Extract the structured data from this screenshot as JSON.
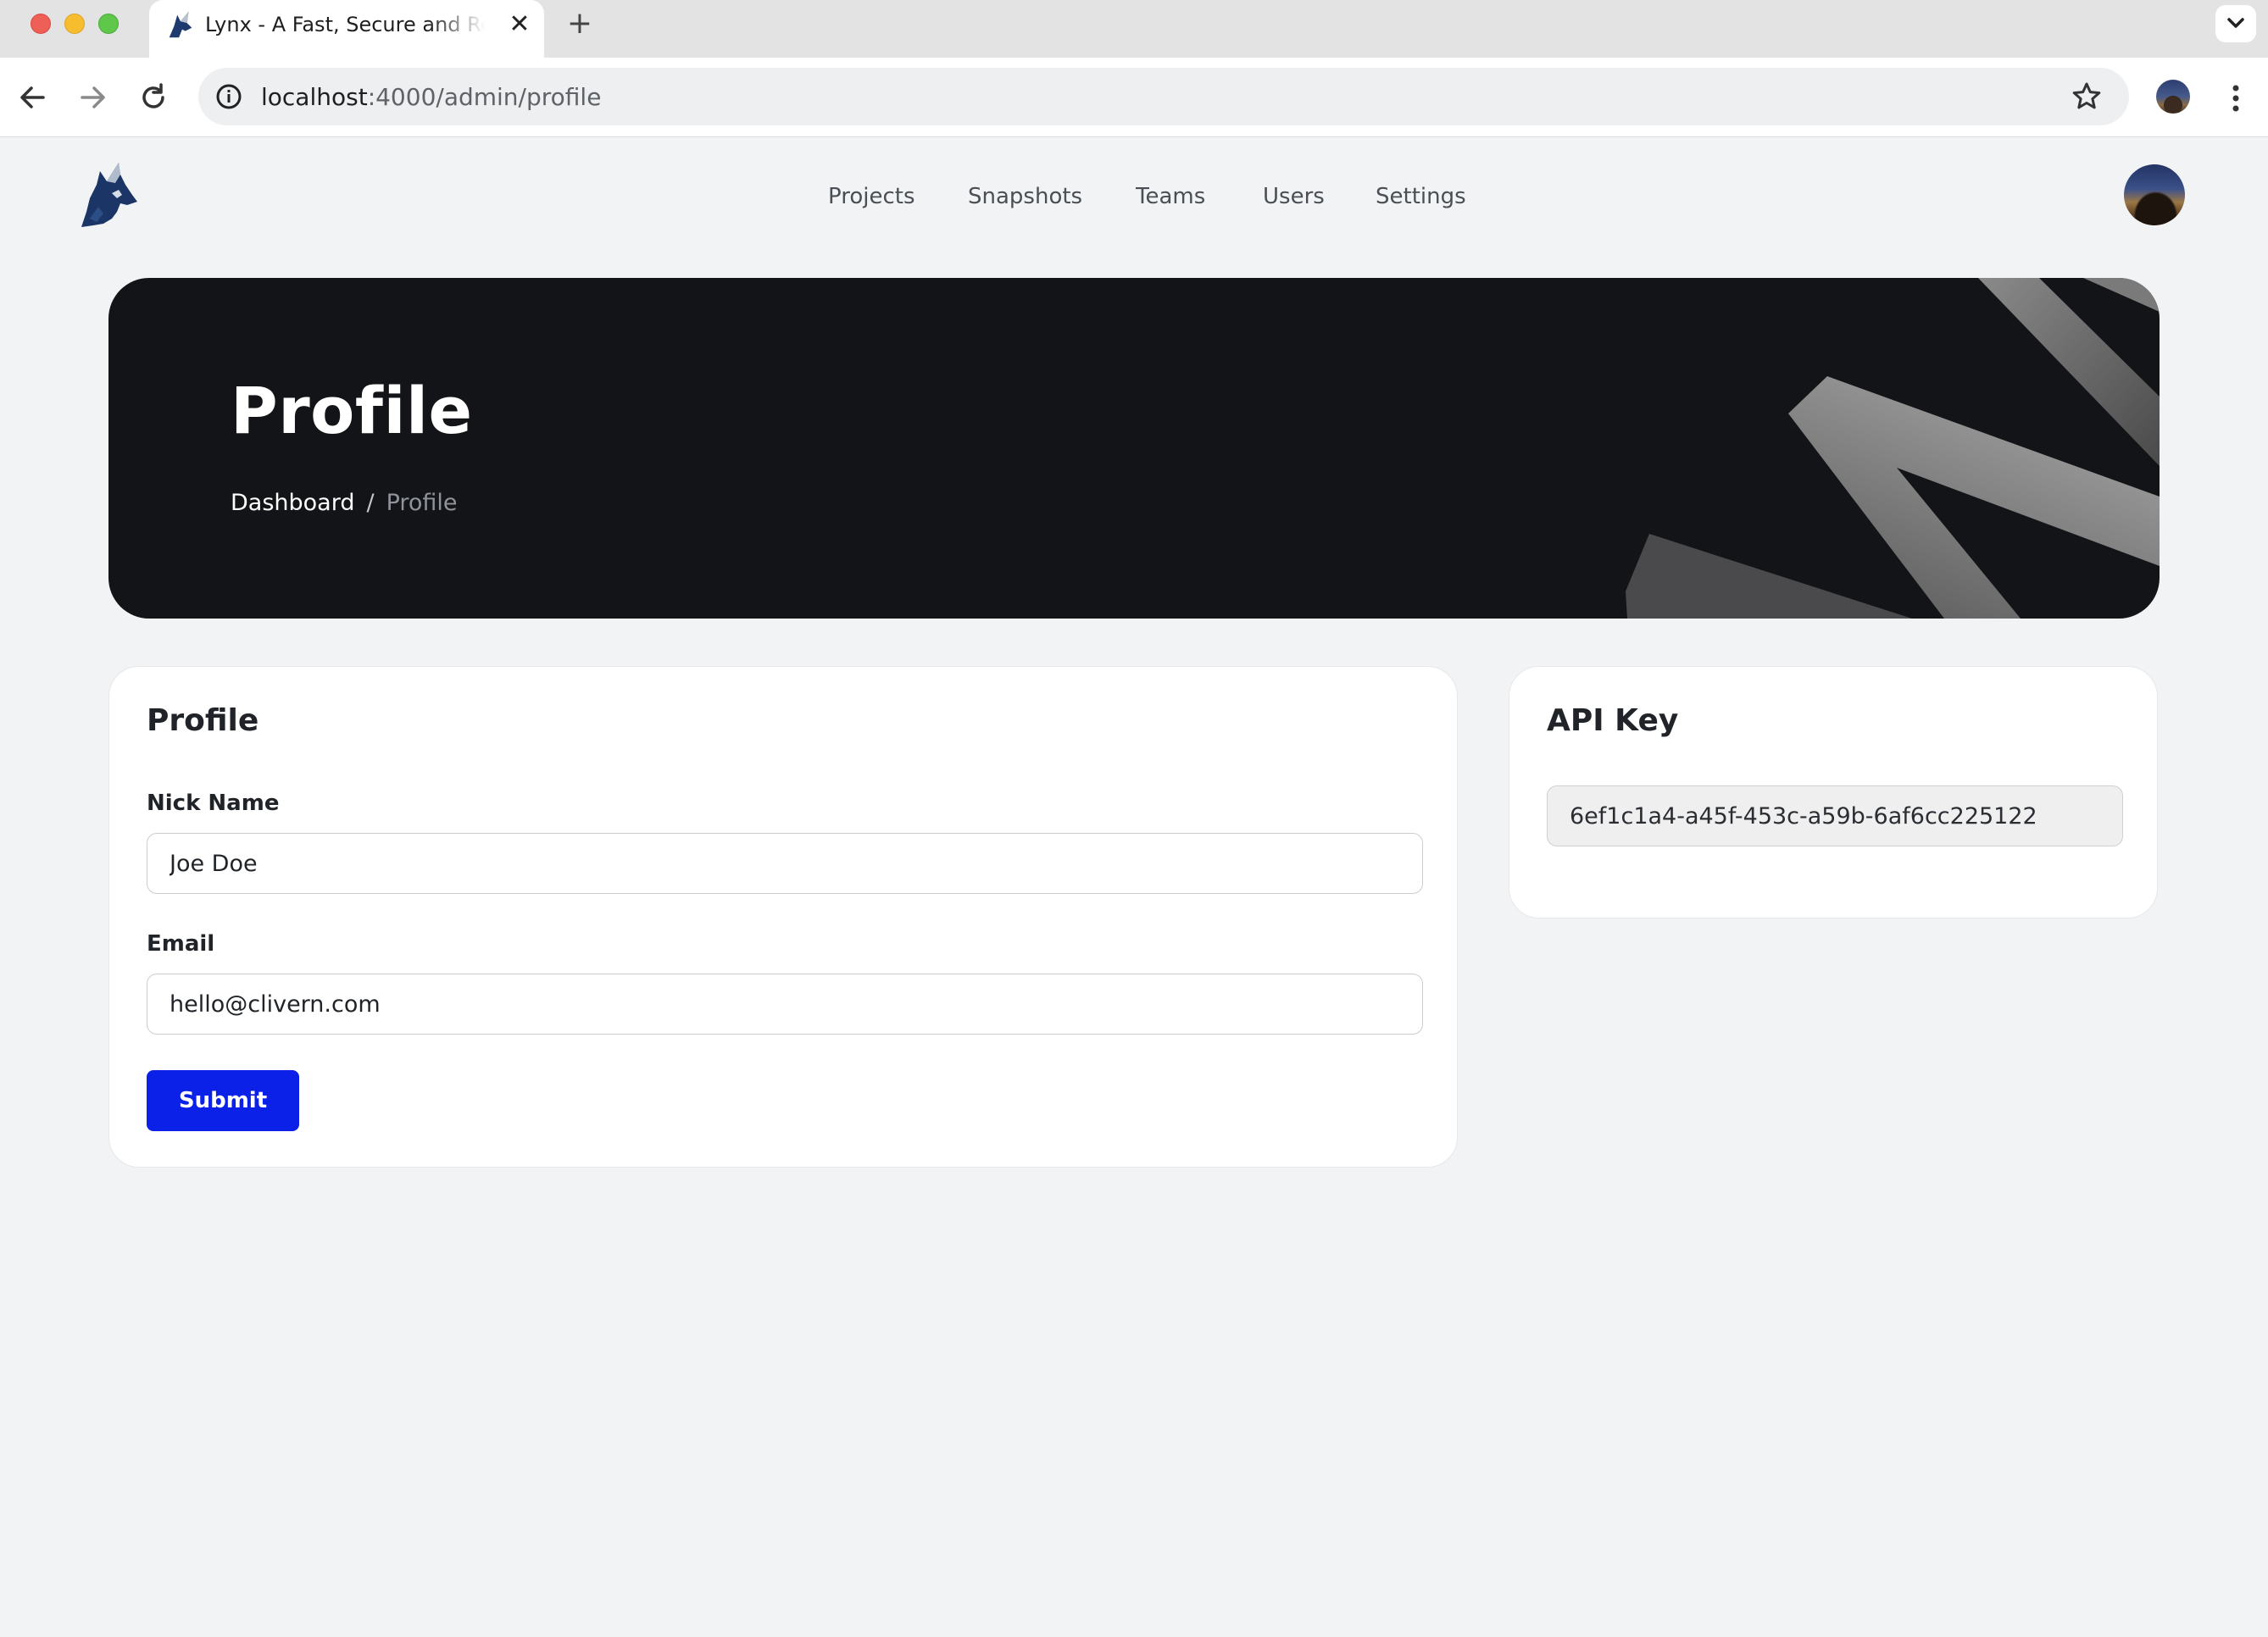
{
  "browser": {
    "tab_title": "Lynx - A Fast, Secure and Reliable",
    "new_tab_label": "+",
    "close_tab_label": "✕",
    "url_host": "localhost",
    "url_rest": ":4000/admin/profile"
  },
  "app": {
    "logo_icon": "wolf-logo-icon",
    "nav": {
      "items": [
        {
          "label": "Projects"
        },
        {
          "label": "Snapshots"
        },
        {
          "label": "Teams"
        },
        {
          "label": "Users"
        },
        {
          "label": "Settings"
        }
      ]
    }
  },
  "hero": {
    "title": "Profile",
    "breadcrumb": {
      "home": "Dashboard",
      "separator": "/",
      "current": "Profile"
    }
  },
  "profile_card": {
    "title": "Profile",
    "nick_name_label": "Nick Name",
    "nick_name_value": "Joe Doe",
    "email_label": "Email",
    "email_value": "hello@clivern.com",
    "submit_label": "Submit"
  },
  "api_card": {
    "title": "API Key",
    "api_key": "6ef1c1a4-a45f-453c-a59b-6af6cc225122"
  },
  "colors": {
    "primary_button": "#0b21e8",
    "hero_background": "#131417",
    "page_background": "#f2f3f5"
  }
}
